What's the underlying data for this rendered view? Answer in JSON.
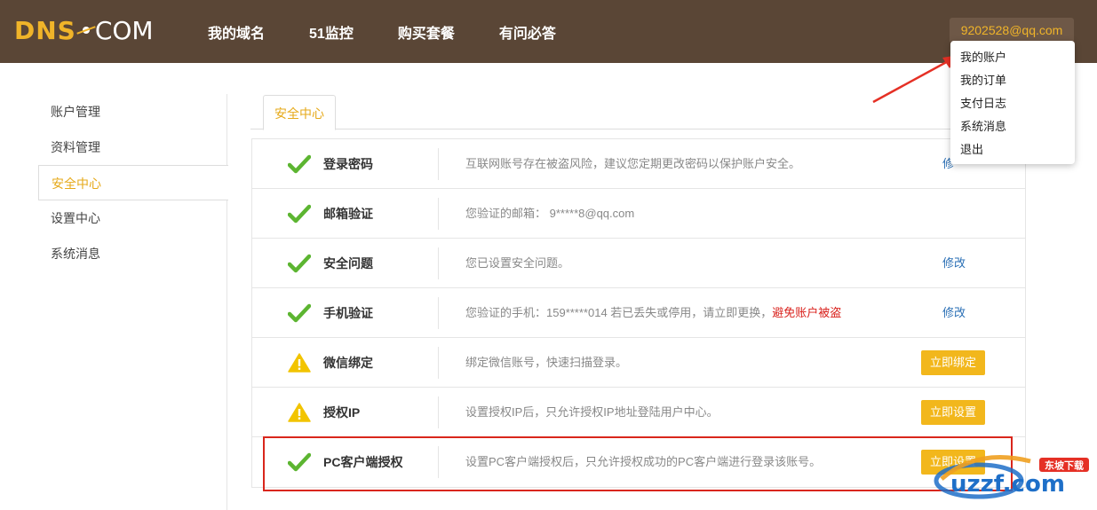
{
  "logo": {
    "part1": "DNS",
    "part2": "COM"
  },
  "nav": [
    "我的域名",
    "51监控",
    "购买套餐",
    "有问必答"
  ],
  "user": {
    "email": "9202528@qq.com",
    "menu": [
      "我的账户",
      "我的订单",
      "支付日志",
      "系统消息",
      "退出"
    ]
  },
  "sidebar": [
    "账户管理",
    "资料管理",
    "安全中心",
    "设置中心",
    "系统消息"
  ],
  "tab": "安全中心",
  "rows": [
    {
      "status": "ok",
      "title": "登录密码",
      "desc": "互联网账号存在被盗风险，建议您定期更改密码以保护账户安全。",
      "action": "修",
      "action_type": "link"
    },
    {
      "status": "ok",
      "title": "邮箱验证",
      "desc": "您验证的邮箱： 9*****8@qq.com",
      "action": "",
      "action_type": "none"
    },
    {
      "status": "ok",
      "title": "安全问题",
      "desc": "您已设置安全问题。",
      "action": "修改",
      "action_type": "link"
    },
    {
      "status": "ok",
      "title": "手机验证",
      "desc": "您验证的手机：159*****014 若已丢失或停用，请立即更换，",
      "desc_warn": "避免账户被盗",
      "action": "修改",
      "action_type": "link"
    },
    {
      "status": "warn",
      "title": "微信绑定",
      "desc": "绑定微信账号，快速扫描登录。",
      "action": "立即绑定",
      "action_type": "button"
    },
    {
      "status": "warn",
      "title": "授权IP",
      "desc": "设置授权IP后，只允许授权IP地址登陆用户中心。",
      "action": "立即设置",
      "action_type": "button"
    },
    {
      "status": "ok",
      "title": "PC客户端授权",
      "desc": "设置PC客户端授权后，只允许授权成功的PC客户端进行登录该账号。",
      "action": "立即设置",
      "action_type": "button"
    }
  ],
  "watermark": {
    "top": "东坡下载",
    "main": "uzzf.com"
  },
  "colors": {
    "header": "#5a4636",
    "accent": "#f0b429",
    "ok": "#5cb531",
    "warn": "#f2c400",
    "link": "#2a6fb5",
    "danger": "#d9201b"
  }
}
